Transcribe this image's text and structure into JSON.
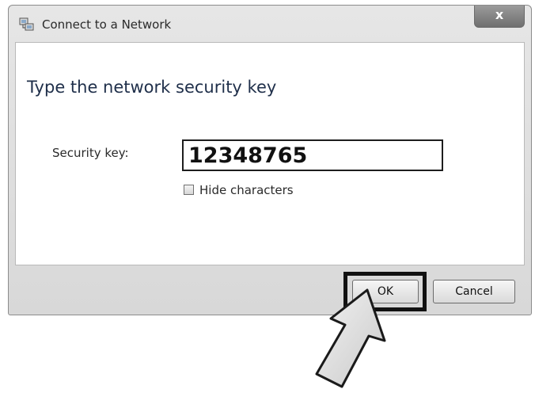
{
  "window": {
    "title": "Connect to a Network",
    "title_icon": "network-connection-icon",
    "close_label": "x"
  },
  "main": {
    "heading": "Type the network security key",
    "security_key": {
      "label": "Security key:",
      "value": "12348765"
    },
    "hide_characters": {
      "label": "Hide characters",
      "checked": false
    }
  },
  "footer": {
    "ok_label": "OK",
    "cancel_label": "Cancel"
  },
  "annotation": {
    "arrow_icon": "pointer-arrow-icon",
    "highlight_target": "OK"
  }
}
